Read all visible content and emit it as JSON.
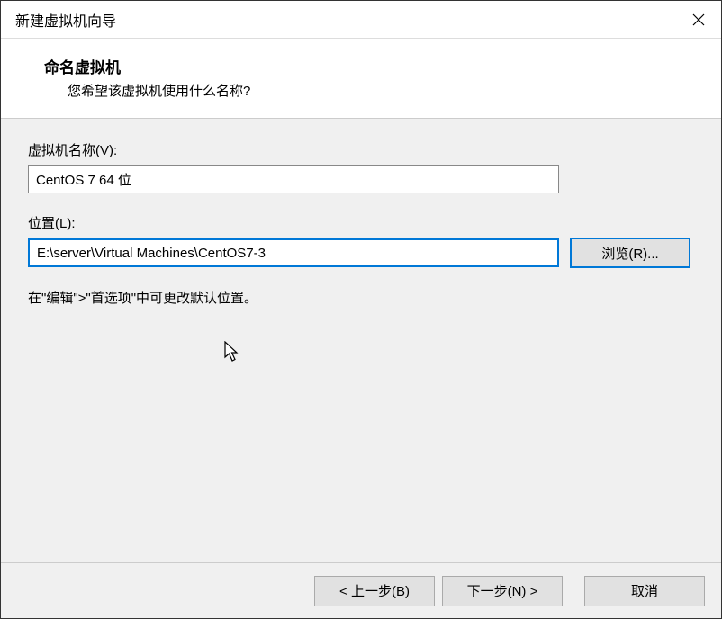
{
  "window": {
    "title": "新建虚拟机向导"
  },
  "header": {
    "title": "命名虚拟机",
    "subtitle": "您希望该虚拟机使用什么名称?"
  },
  "fields": {
    "name_label": "虚拟机名称(V):",
    "name_value": "CentOS 7 64 位",
    "location_label": "位置(L):",
    "location_value": "E:\\server\\Virtual Machines\\CentOS7-3",
    "browse_label": "浏览(R)..."
  },
  "hint": "在\"编辑\">\"首选项\"中可更改默认位置。",
  "buttons": {
    "back": "< 上一步(B)",
    "next": "下一步(N) >",
    "cancel": "取消"
  }
}
